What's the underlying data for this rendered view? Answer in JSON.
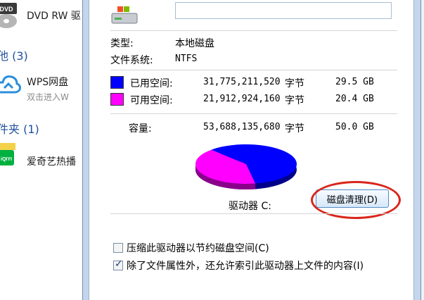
{
  "left_panel": {
    "items": [
      {
        "title": "DVD RW 驱",
        "icon": "dvd-drive-icon",
        "icon_label": "DVD"
      },
      {
        "title": "WPS网盘",
        "subtitle": "双击进入W",
        "icon": "wps-cloud-icon"
      },
      {
        "title": "爱奇艺热播",
        "icon": "iqiyi-icon",
        "icon_label": "iQIYI"
      }
    ],
    "groups": [
      "他 (3)",
      "件夹 (1)"
    ]
  },
  "dialog": {
    "drive_name_value": "",
    "type_label": "类型:",
    "type_value": "本地磁盘",
    "fs_label": "文件系统:",
    "fs_value": "NTFS",
    "used": {
      "label": "已用空间:",
      "bytes": "31,775,211,520",
      "unit": "字节",
      "size": "29.5 GB",
      "color": "#0000ff"
    },
    "free": {
      "label": "可用空间:",
      "bytes": "21,912,924,160",
      "unit": "字节",
      "size": "20.4 GB",
      "color": "#ff00ff"
    },
    "capacity": {
      "label": "容量:",
      "bytes": "53,688,135,680",
      "unit": "字节",
      "size": "50.0 GB"
    },
    "drive_label": "驱动器 C:",
    "cleanup_button": "磁盘清理(D)",
    "compress_label": "压缩此驱动器以节约磁盘空间(C)",
    "compress_checked": false,
    "index_label": "除了文件属性外，还允许索引此驱动器上文件的内容(I)",
    "index_checked": true
  },
  "colors": {
    "used": "#0000ff",
    "free": "#ff00ff",
    "highlight": "#d9261c"
  }
}
